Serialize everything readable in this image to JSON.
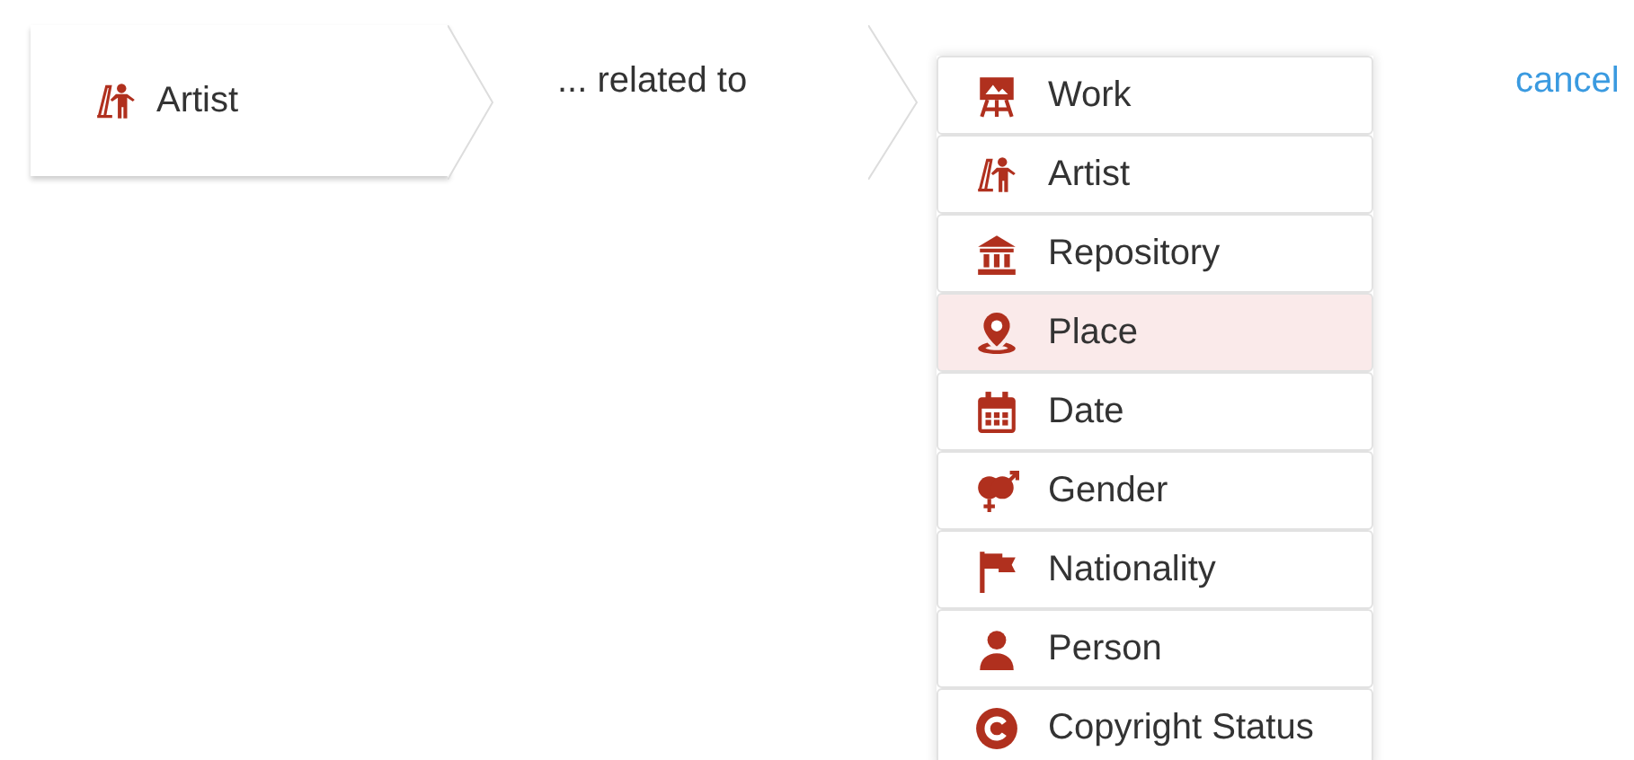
{
  "breadcrumb": {
    "step": {
      "label": "Artist",
      "kind": "artist"
    },
    "relation": "... related to"
  },
  "options": [
    {
      "label": "Work",
      "kind": "easel",
      "selected": false
    },
    {
      "label": "Artist",
      "kind": "artist",
      "selected": false
    },
    {
      "label": "Repository",
      "kind": "museum",
      "selected": false
    },
    {
      "label": "Place",
      "kind": "pin",
      "selected": true
    },
    {
      "label": "Date",
      "kind": "calendar",
      "selected": false
    },
    {
      "label": "Gender",
      "kind": "gender",
      "selected": false
    },
    {
      "label": "Nationality",
      "kind": "flag",
      "selected": false
    },
    {
      "label": "Person",
      "kind": "person",
      "selected": false
    },
    {
      "label": "Copyright Status",
      "kind": "copyright",
      "selected": false
    }
  ],
  "cancel": "cancel"
}
